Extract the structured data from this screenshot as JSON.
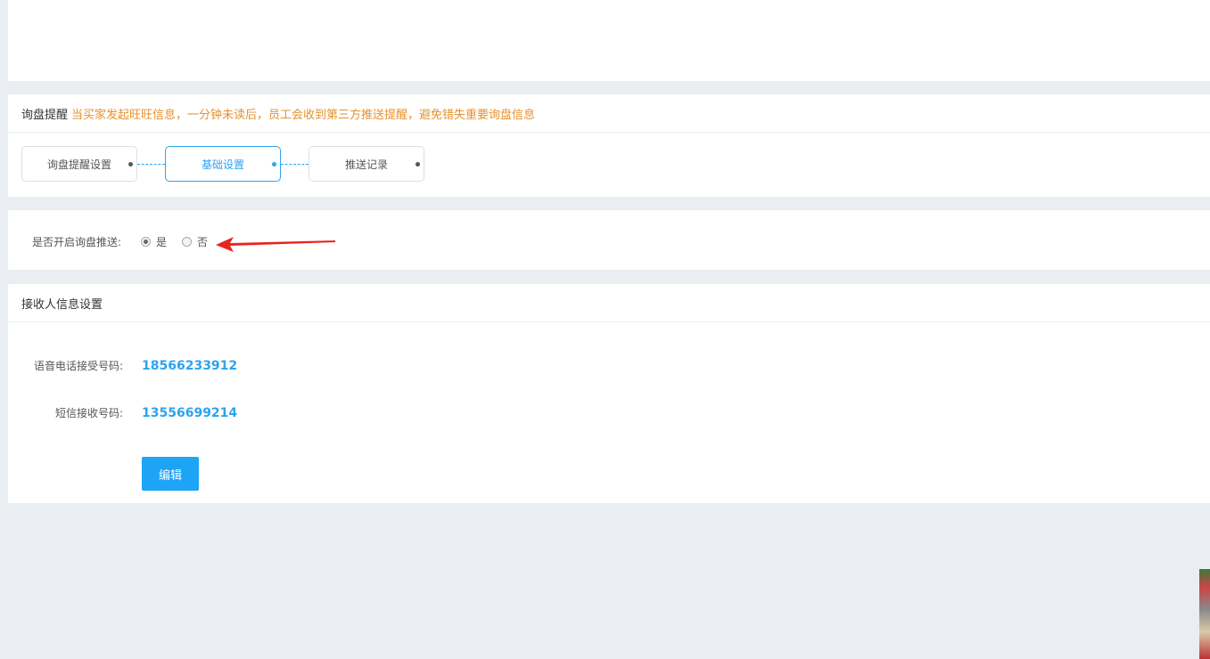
{
  "inquiry": {
    "title": "询盘提醒",
    "description": "当买家发起旺旺信息，一分钟未读后，员工会收到第三方推送提醒，避免错失重要询盘信息",
    "steps": [
      {
        "label": "询盘提醒设置",
        "active": false
      },
      {
        "label": "基础设置",
        "active": true
      },
      {
        "label": "推送记录",
        "active": false
      }
    ]
  },
  "push": {
    "label": "是否开启询盘推送:",
    "options": [
      {
        "label": "是",
        "checked": true
      },
      {
        "label": "否",
        "checked": false
      }
    ]
  },
  "receiver": {
    "title": "接收人信息设置",
    "voice_label": "语音电话接受号码:",
    "voice_number": "18566233912",
    "sms_label": "短信接收号码:",
    "sms_number": "13556699214",
    "edit_label": "编辑"
  },
  "colors": {
    "accent": "#2ba3f2",
    "warning_text": "#e6912d",
    "annotation_arrow": "#e8231f",
    "background": "#eaedf1"
  }
}
